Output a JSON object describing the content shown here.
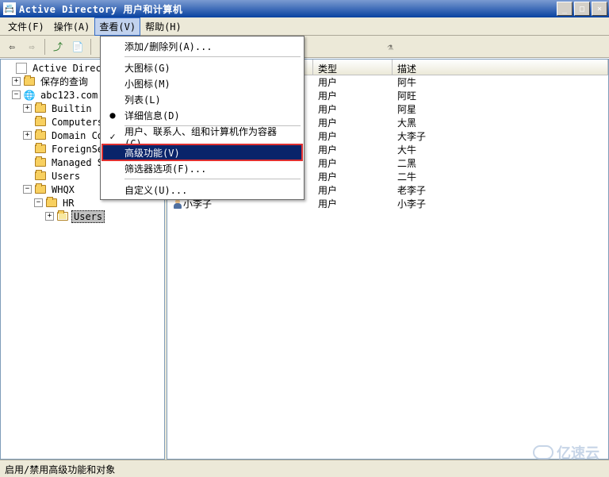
{
  "window": {
    "title": "Active Directory 用户和计算机"
  },
  "menubar": {
    "file": "文件(F)",
    "action": "操作(A)",
    "view": "查看(V)",
    "help": "帮助(H)"
  },
  "view_menu": {
    "add_remove_cols": "添加/删除列(A)...",
    "large_icons": "大图标(G)",
    "small_icons": "小图标(M)",
    "list": "列表(L)",
    "details": "详细信息(D)",
    "containers": "用户、联系人、组和计算机作为容器(C)",
    "advanced": "高级功能(V)",
    "filter": "筛选器选项(F)...",
    "customize": "自定义(U)..."
  },
  "tree": {
    "root": "Active Directory",
    "saved_queries": "保存的查询",
    "domain": "abc123.com",
    "children": [
      "Builtin",
      "Computers",
      "Domain Co",
      "ForeignSe",
      "Managed S",
      "Users",
      "WHQX"
    ],
    "sub_hr": "HR",
    "sub_users": "Users"
  },
  "list": {
    "visible_name": "小李子",
    "columns": {
      "name": "",
      "type": "类型",
      "desc": "描述"
    },
    "rows": [
      {
        "type": "用户",
        "desc": "阿牛"
      },
      {
        "type": "用户",
        "desc": "阿旺"
      },
      {
        "type": "用户",
        "desc": "阿星"
      },
      {
        "type": "用户",
        "desc": "大黑"
      },
      {
        "type": "用户",
        "desc": "大李子"
      },
      {
        "type": "用户",
        "desc": "大牛"
      },
      {
        "type": "用户",
        "desc": "二黑"
      },
      {
        "type": "用户",
        "desc": "二牛"
      },
      {
        "type": "用户",
        "desc": "老李子"
      },
      {
        "type": "用户",
        "desc": "小李子"
      }
    ]
  },
  "statusbar": "启用/禁用高级功能和对象",
  "watermark": "亿速云"
}
